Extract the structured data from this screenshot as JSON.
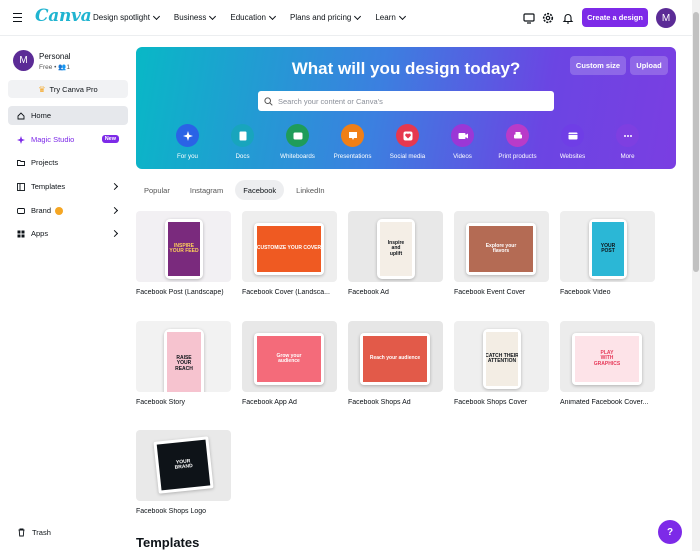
{
  "topbar": {
    "logo": "Canva",
    "nav": [
      "Design spotlight",
      "Business",
      "Education",
      "Plans and pricing",
      "Learn"
    ],
    "create_label": "Create a design",
    "avatar_initial": "M"
  },
  "sidebar": {
    "profile_name": "Personal",
    "profile_plan": "Free • 👥1",
    "avatar_initial": "M",
    "try_pro": "Try Canva Pro",
    "items": [
      {
        "label": "Home"
      },
      {
        "label": "Magic Studio",
        "badge": "New"
      },
      {
        "label": "Projects"
      },
      {
        "label": "Templates"
      },
      {
        "label": "Brand"
      },
      {
        "label": "Apps"
      }
    ],
    "trash": "Trash"
  },
  "hero": {
    "title": "What will you design today?",
    "custom_size": "Custom size",
    "upload": "Upload",
    "search_placeholder": "Search your content or Canva's",
    "categories": [
      {
        "label": "For you",
        "icon": "sparkle-icon",
        "color": "#2a63e6"
      },
      {
        "label": "Docs",
        "icon": "docs-icon",
        "color": "#18a5bd"
      },
      {
        "label": "Whiteboards",
        "icon": "whiteboard-icon",
        "color": "#1f9c5a"
      },
      {
        "label": "Presentations",
        "icon": "presentation-icon",
        "color": "#f07f16"
      },
      {
        "label": "Social media",
        "icon": "heart-icon",
        "color": "#e6384f"
      },
      {
        "label": "Videos",
        "icon": "video-icon",
        "color": "#9b37d6"
      },
      {
        "label": "Print products",
        "icon": "print-icon",
        "color": "#b93bc9"
      },
      {
        "label": "Websites",
        "icon": "website-icon",
        "color": "#6f3ee6"
      },
      {
        "label": "More",
        "icon": "more-icon",
        "color": "#7e3fe1"
      }
    ]
  },
  "tabs": [
    "Popular",
    "Instagram",
    "Facebook",
    "LinkedIn"
  ],
  "cards": [
    {
      "label": "Facebook Post (Landscape)",
      "art": [
        "INSPIRE",
        "YOUR FEED"
      ]
    },
    {
      "label": "Facebook Cover (Landsca...",
      "art": [
        "CUSTOMIZE YOUR COVER"
      ]
    },
    {
      "label": "Facebook Ad",
      "art": [
        "Inspire",
        "and",
        "uplift"
      ]
    },
    {
      "label": "Facebook Event Cover",
      "art": [
        "Explore your",
        "flavors"
      ]
    },
    {
      "label": "Facebook Video",
      "art": [
        "YOUR",
        "POST"
      ]
    },
    {
      "label": "Facebook Story",
      "art": [
        "RAISE",
        "YOUR",
        "REACH"
      ]
    },
    {
      "label": "Facebook App Ad",
      "art": [
        "Grow your",
        "audience"
      ]
    },
    {
      "label": "Facebook Shops Ad",
      "art": [
        "Reach your audience"
      ]
    },
    {
      "label": "Facebook Shops Cover",
      "art": [
        "CATCH THEIR",
        "ATTENTION"
      ]
    },
    {
      "label": "Animated Facebook Cover...",
      "art": [
        "PLAY",
        "WITH",
        "GRAPHICS"
      ]
    },
    {
      "label": "Facebook Shops Logo",
      "art": [
        "YOUR",
        "BRAND"
      ]
    }
  ],
  "templates_heading": "Templates",
  "help": "?"
}
